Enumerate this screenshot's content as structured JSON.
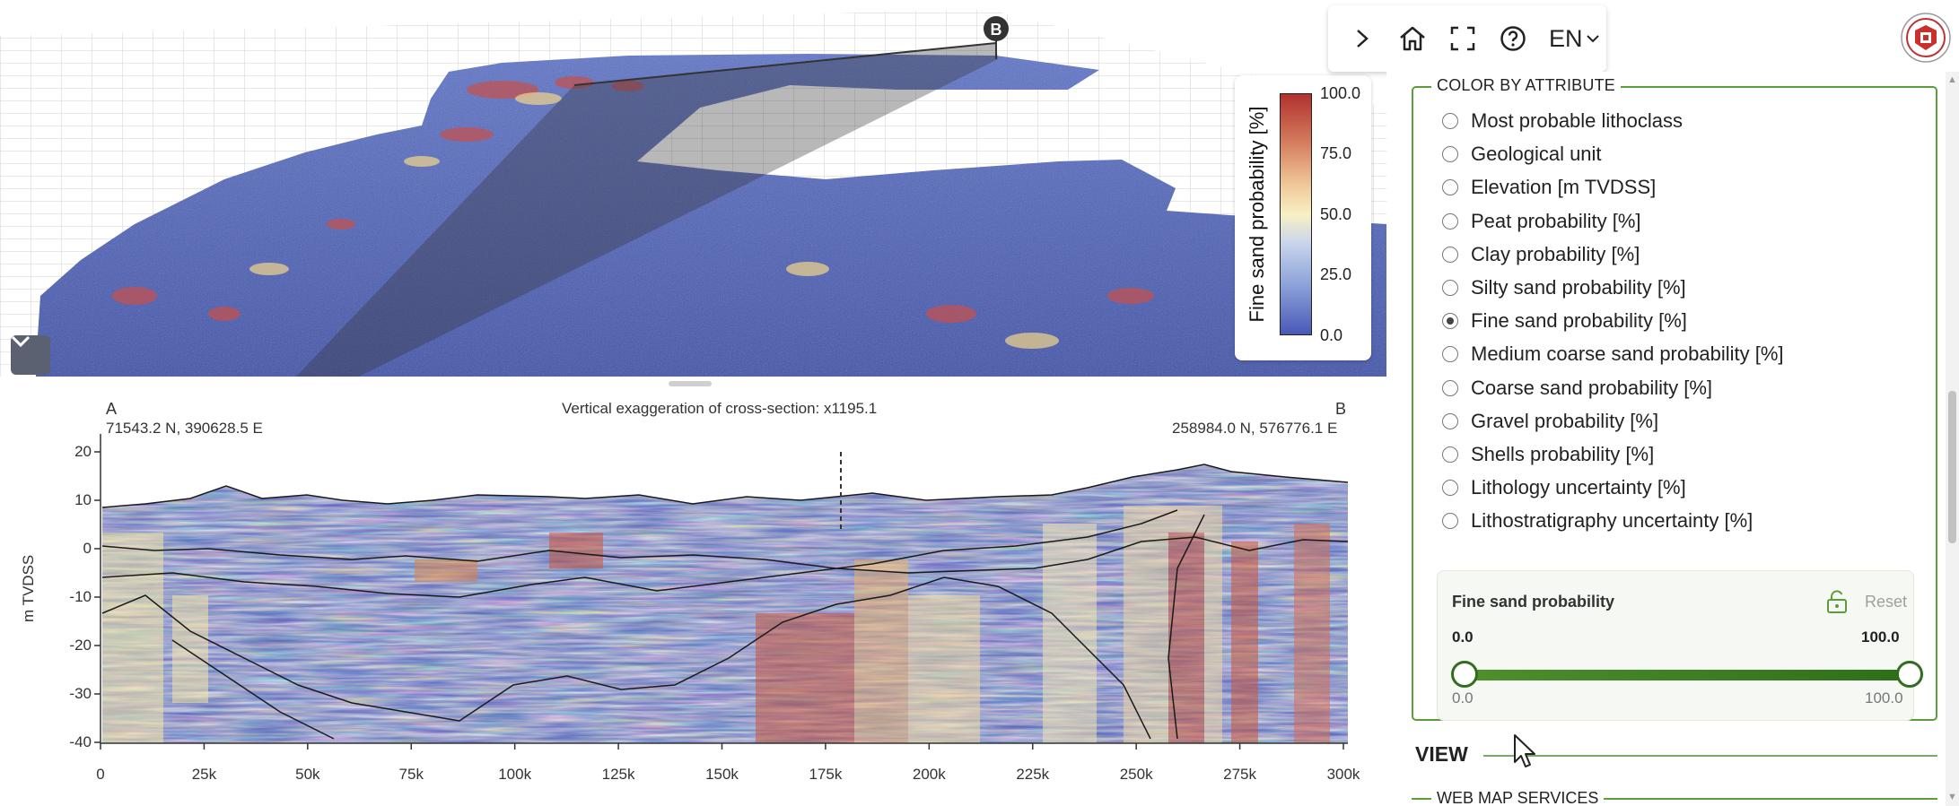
{
  "viewer": {
    "marker_b": "B",
    "legend": {
      "title": "Fine sand probability [%]",
      "ticks": [
        "100.0",
        "75.0",
        "50.0",
        "25.0",
        "0.0"
      ]
    }
  },
  "section": {
    "label_a": "A",
    "coord_a": "71543.2 N, 390628.5 E",
    "label_b": "B",
    "coord_b": "258984.0 N, 576776.1 E",
    "exaggeration": "Vertical exaggeration of cross-section: x1195.1",
    "ylabel": "m TVDSS",
    "y_ticks": [
      "20",
      "10",
      "0",
      "-10",
      "-20",
      "-30",
      "-40"
    ],
    "x_ticks": [
      "0",
      "25k",
      "50k",
      "75k",
      "100k",
      "125k",
      "150k",
      "175k",
      "200k",
      "225k",
      "250k",
      "275k",
      "300k"
    ]
  },
  "toolbar": {
    "expand_icon": "chevron-right-icon",
    "home_icon": "home-icon",
    "fullscreen_icon": "fullscreen-icon",
    "help_icon": "help-icon",
    "language": "EN"
  },
  "color_by": {
    "heading": "COLOR BY ATTRIBUTE",
    "options": [
      {
        "label": "Most probable lithoclass",
        "checked": false
      },
      {
        "label": "Geological unit",
        "checked": false
      },
      {
        "label": "Elevation [m TVDSS]",
        "checked": false
      },
      {
        "label": "Peat probability [%]",
        "checked": false
      },
      {
        "label": "Clay probability [%]",
        "checked": false
      },
      {
        "label": "Silty sand probability [%]",
        "checked": false
      },
      {
        "label": "Fine sand probability [%]",
        "checked": true
      },
      {
        "label": "Medium coarse sand probability [%]",
        "checked": false
      },
      {
        "label": "Coarse sand probability [%]",
        "checked": false
      },
      {
        "label": "Gravel probability [%]",
        "checked": false
      },
      {
        "label": "Shells probability [%]",
        "checked": false
      },
      {
        "label": "Lithology uncertainty [%]",
        "checked": false
      },
      {
        "label": "Lithostratigraphy uncertainty [%]",
        "checked": false
      }
    ],
    "range": {
      "title": "Fine sand probability",
      "reset": "Reset",
      "min_value": "0.0",
      "max_value": "100.0",
      "min_limit": "0.0",
      "max_limit": "100.0",
      "low_fraction": 0,
      "high_fraction": 1
    }
  },
  "view": {
    "heading": "VIEW",
    "wms_heading": "WEB MAP SERVICES"
  },
  "colors": {
    "accent": "#5a9e3a",
    "slider": "#2f6e1a",
    "low": "#4858b8",
    "high": "#b2312e"
  }
}
